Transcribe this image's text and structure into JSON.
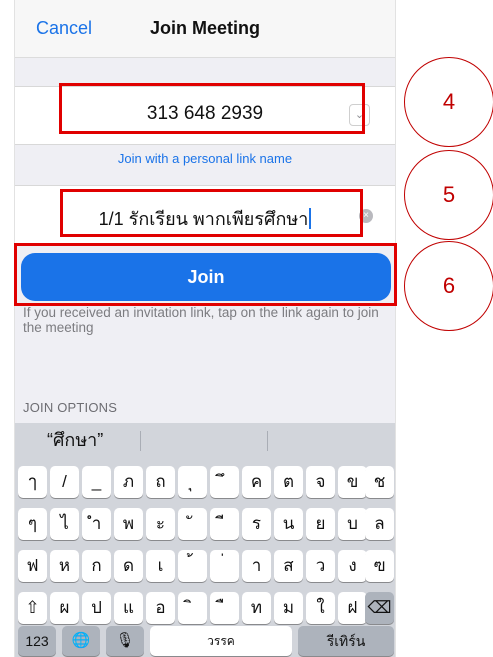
{
  "navbar": {
    "cancel_label": "Cancel",
    "title": "Join Meeting"
  },
  "meeting": {
    "id_value": "313 648 2939",
    "dropdown_glyph": "⌄",
    "personal_link_label": "Join with a personal link name"
  },
  "name_field": {
    "value": "1/1 รักเรียน พากเพียรศึกษา",
    "clear_glyph": "×"
  },
  "join": {
    "label": "Join"
  },
  "hint": "If you received an invitation link, tap on the link again to join the meeting",
  "join_options_label": "JOIN OPTIONS",
  "keyboard": {
    "suggestions": [
      "“ศึกษา”",
      "",
      ""
    ],
    "row1": [
      "ๅ",
      "/",
      "_",
      "ภ",
      "ถ",
      "ุ",
      "ึ",
      "ค",
      "ต",
      "จ",
      "ข",
      "ช"
    ],
    "row2": [
      "ๆ",
      "ไ",
      "ำ",
      "พ",
      "ะ",
      "ั",
      "ี",
      "ร",
      "น",
      "ย",
      "บ",
      "ล"
    ],
    "row3": [
      "ฟ",
      "ห",
      "ก",
      "ด",
      "เ",
      "้",
      "่",
      "า",
      "ส",
      "ว",
      "ง",
      "ฃ"
    ],
    "row4": [
      "ผ",
      "ป",
      "แ",
      "อ",
      "ิ",
      "ื",
      "ท",
      "ม",
      "ใ",
      "ฝ"
    ],
    "shift_glyph": "⇧",
    "backspace_glyph": "⌫",
    "numbers_label": "123",
    "globe_glyph": "🌐",
    "mic_glyph": "🎙",
    "space_label": "วรรค",
    "return_label": "รีเทิร์น"
  },
  "annotations": {
    "box4_label": "4",
    "box5_label": "5",
    "box6_label": "6"
  },
  "colors": {
    "accent": "#1a73e8",
    "annotation_red": "#e00000"
  }
}
